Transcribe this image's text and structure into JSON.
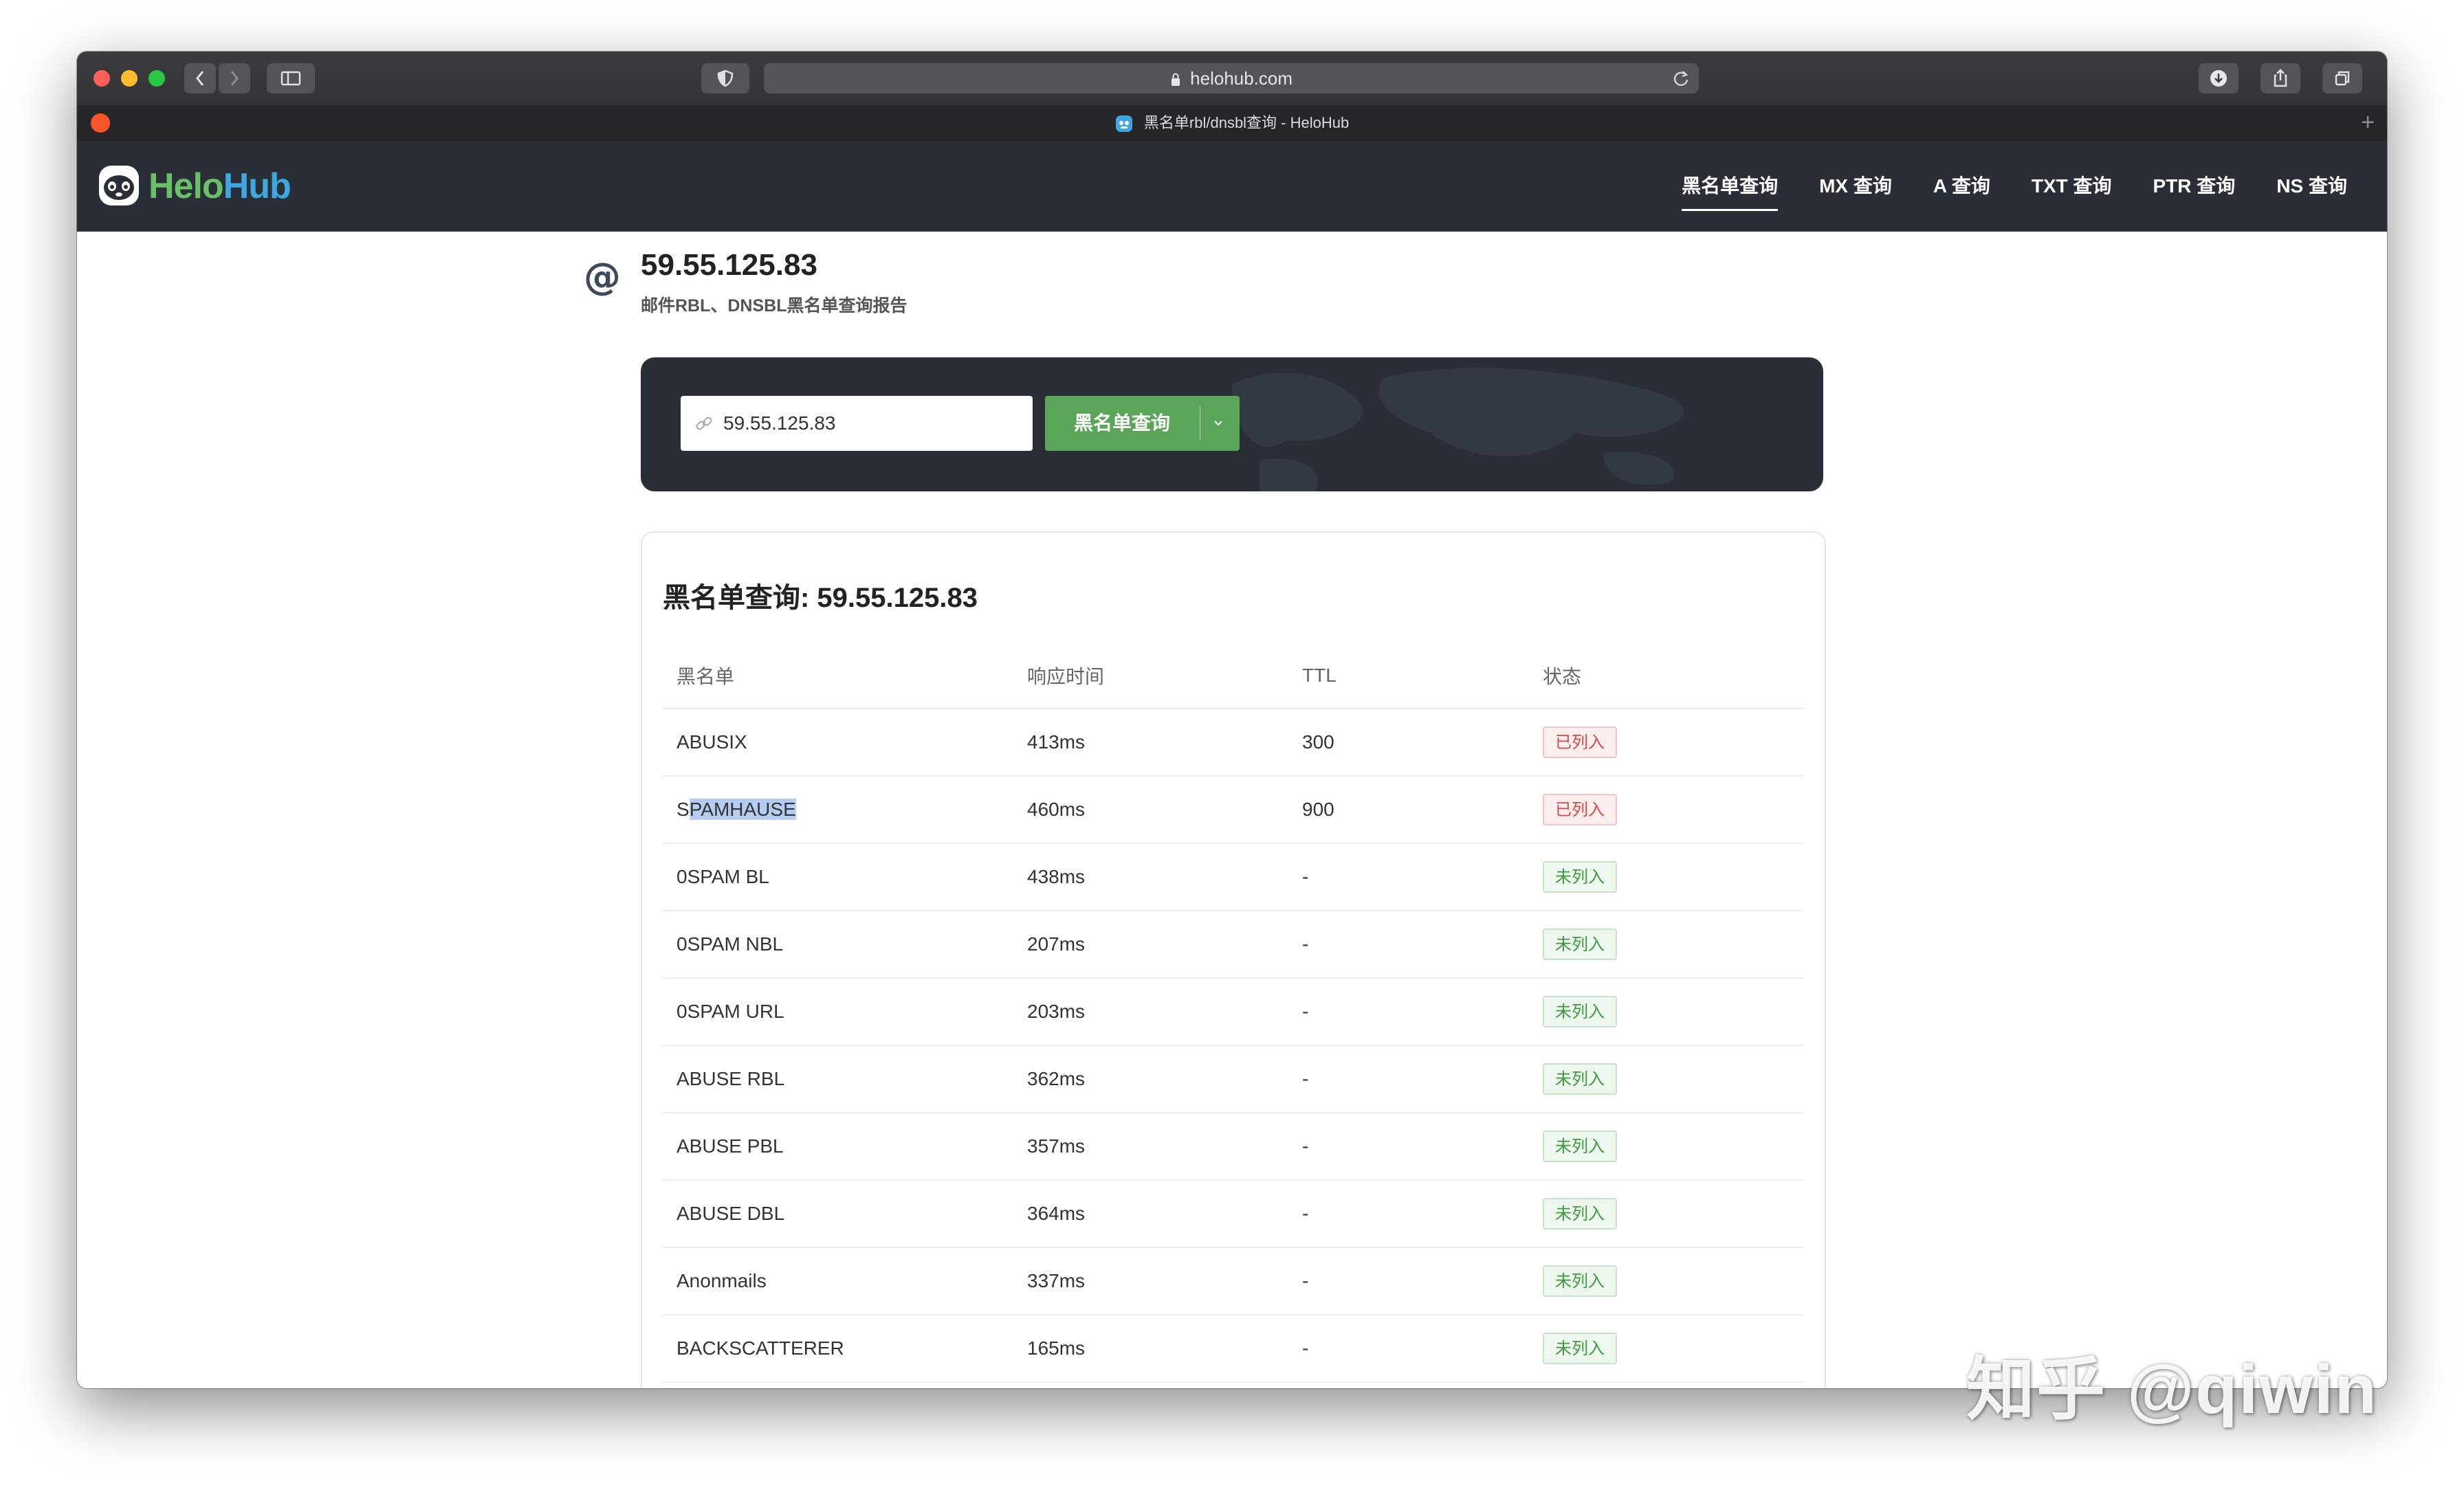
{
  "browser": {
    "url": "helohub.com",
    "tab_title": "黑名单rbl/dnsbl查询 - HeloHub"
  },
  "site": {
    "logo_part1": "Helo",
    "logo_part2": "Hub",
    "nav": [
      {
        "label": "黑名单查询",
        "active": true
      },
      {
        "label": "MX 查询"
      },
      {
        "label": "A 查询"
      },
      {
        "label": "TXT 查询"
      },
      {
        "label": "PTR 查询"
      },
      {
        "label": "NS 查询"
      }
    ]
  },
  "page": {
    "ip": "59.55.125.83",
    "subtitle": "邮件RBL、DNSBL黑名单查询报告"
  },
  "search": {
    "value": "59.55.125.83",
    "button_label": "黑名单查询"
  },
  "results": {
    "title": "黑名单查询: 59.55.125.83",
    "headers": [
      "黑名单",
      "响应时间",
      "TTL",
      "状态"
    ],
    "rows": [
      {
        "name_a": "ABUSIX",
        "name_b": "",
        "time": "413ms",
        "ttl": "300",
        "status": "已列入",
        "listed": true
      },
      {
        "name_a": "S",
        "name_b": "PAMHAUSE",
        "time": "460ms",
        "ttl": "900",
        "status": "已列入",
        "listed": true
      },
      {
        "name_a": "0SPAM BL",
        "name_b": "",
        "time": "438ms",
        "ttl": "-",
        "status": "未列入",
        "listed": false
      },
      {
        "name_a": "0SPAM NBL",
        "name_b": "",
        "time": "207ms",
        "ttl": "-",
        "status": "未列入",
        "listed": false
      },
      {
        "name_a": "0SPAM URL",
        "name_b": "",
        "time": "203ms",
        "ttl": "-",
        "status": "未列入",
        "listed": false
      },
      {
        "name_a": "ABUSE RBL",
        "name_b": "",
        "time": "362ms",
        "ttl": "-",
        "status": "未列入",
        "listed": false
      },
      {
        "name_a": "ABUSE PBL",
        "name_b": "",
        "time": "357ms",
        "ttl": "-",
        "status": "未列入",
        "listed": false
      },
      {
        "name_a": "ABUSE DBL",
        "name_b": "",
        "time": "364ms",
        "ttl": "-",
        "status": "未列入",
        "listed": false
      },
      {
        "name_a": "Anonmails",
        "name_b": "",
        "time": "337ms",
        "ttl": "-",
        "status": "未列入",
        "listed": false
      },
      {
        "name_a": "BACKSCATTERER",
        "name_b": "",
        "time": "165ms",
        "ttl": "-",
        "status": "未列入",
        "listed": false
      }
    ]
  },
  "watermark": "知乎 @qiwin"
}
